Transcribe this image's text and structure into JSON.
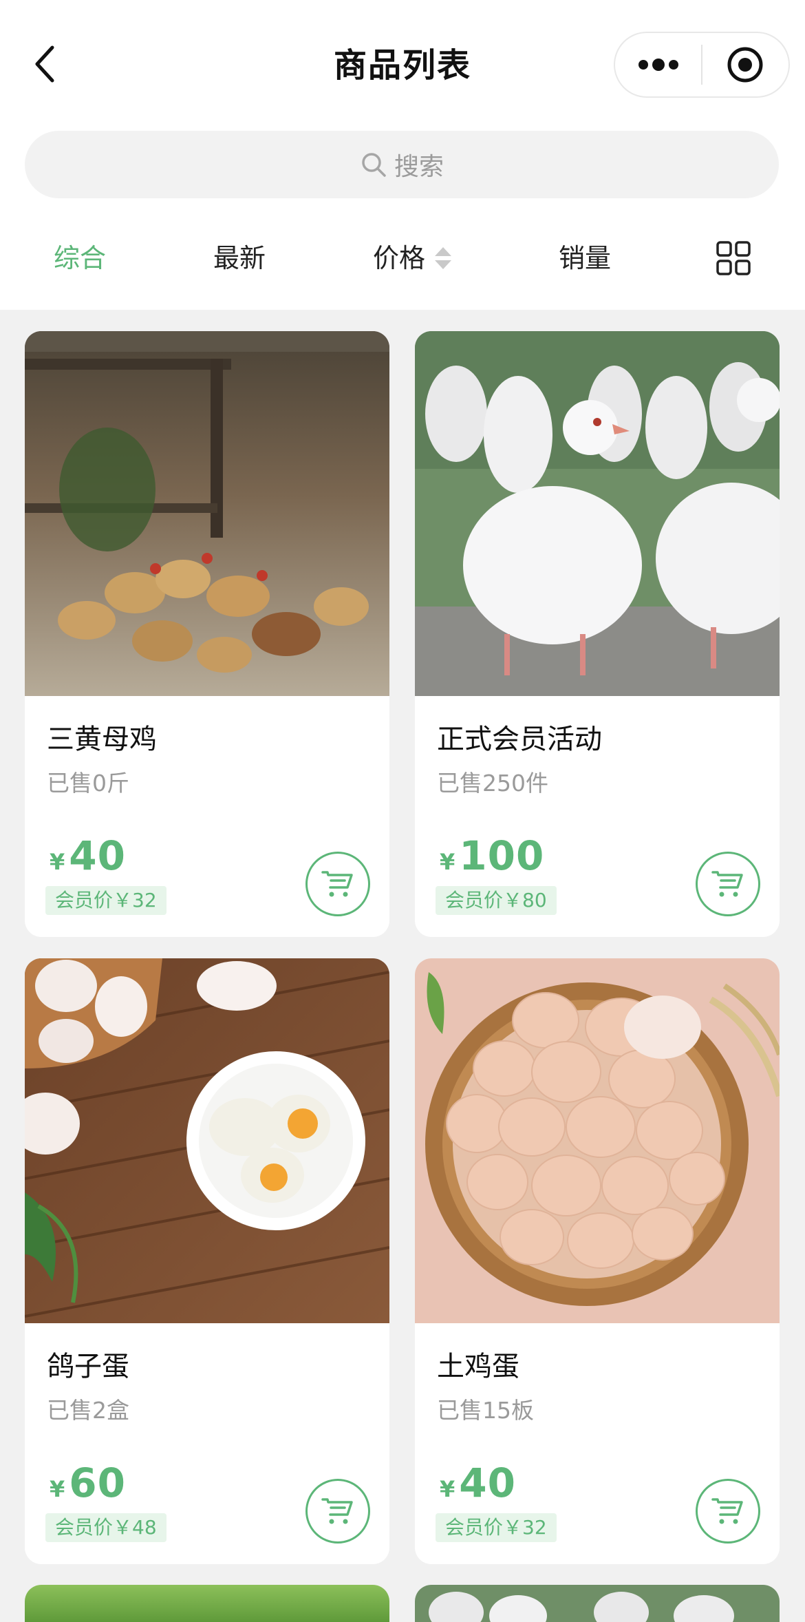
{
  "header": {
    "title": "商品列表",
    "back_icon": "chevron-left-icon",
    "more_icon": "more-dots-icon",
    "close_icon": "target-close-icon"
  },
  "search": {
    "placeholder": "搜索",
    "icon": "search-icon"
  },
  "tabs": [
    {
      "label": "综合",
      "active": true
    },
    {
      "label": "最新",
      "active": false
    },
    {
      "label": "价格",
      "active": false,
      "sort_icon": "sort-arrows-icon"
    },
    {
      "label": "销量",
      "active": false
    },
    {
      "icon": "grid-view-icon"
    }
  ],
  "products": [
    {
      "name": "三黄母鸡",
      "sold": "已售0斤",
      "currency": "¥",
      "price": "40",
      "member_price": "会员价￥32",
      "image": "chickens-photo"
    },
    {
      "name": "正式会员活动",
      "sold": "已售250件",
      "currency": "¥",
      "price": "100",
      "member_price": "会员价￥80",
      "image": "white-pigeons-photo"
    },
    {
      "name": "鸽子蛋",
      "sold": "已售2盒",
      "currency": "¥",
      "price": "60",
      "member_price": "会员价￥48",
      "image": "pigeon-eggs-photo"
    },
    {
      "name": "土鸡蛋",
      "sold": "已售15板",
      "currency": "¥",
      "price": "40",
      "member_price": "会员价￥32",
      "image": "basket-of-eggs-photo"
    }
  ],
  "colors": {
    "accent": "#5cb678",
    "member_bg": "#e7f5ea",
    "page_bg": "#f1f1f1"
  }
}
